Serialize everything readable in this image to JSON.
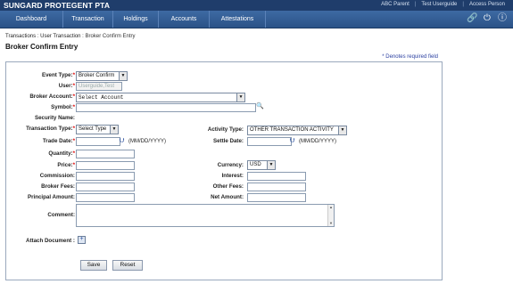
{
  "brand": "SUNGARD PROTEGENT PTA",
  "top_links": [
    "ABC Parent",
    "Test Userguide",
    "Access Person"
  ],
  "nav": {
    "items": [
      "Dashboard",
      "Transaction",
      "Holdings",
      "Accounts",
      "Attestations"
    ],
    "icons": [
      "link-icon",
      "power-icon",
      "help-icon"
    ]
  },
  "breadcrumb": [
    "Transactions",
    "User Transaction",
    "Broker Confirm Entry"
  ],
  "page_title": "Broker Confirm Entry",
  "required_note": "* Denotes required field",
  "form": {
    "event_type": {
      "label": "Event Type:",
      "value": "Broker Confirm"
    },
    "user": {
      "label": "User:",
      "placeholder": "Userguide,Test"
    },
    "broker_account": {
      "label": "Broker Account:",
      "value": "Select Account"
    },
    "symbol": {
      "label": "Symbol:",
      "value": ""
    },
    "security_name": {
      "label": "Security Name:"
    },
    "transaction_type": {
      "label": "Transaction Type:",
      "value": "Select Type"
    },
    "activity_type": {
      "label": "Activity Type:",
      "value": "OTHER TRANSACTION ACTIVITY"
    },
    "trade_date": {
      "label": "Trade Date:",
      "format": "(MM/DD/YYYY)"
    },
    "settle_date": {
      "label": "Settle Date:",
      "format": "(MM/DD/YYYY)"
    },
    "quantity": {
      "label": "Quantity:"
    },
    "price": {
      "label": "Price:"
    },
    "currency": {
      "label": "Currency:",
      "value": "USD"
    },
    "commission": {
      "label": "Commission:"
    },
    "interest": {
      "label": "Interest:"
    },
    "broker_fees": {
      "label": "Broker Fees:"
    },
    "other_fees": {
      "label": "Other Fees:"
    },
    "principal_amount": {
      "label": "Principal Amount:"
    },
    "net_amount": {
      "label": "Net Amount:"
    },
    "comment": {
      "label": "Comment:"
    },
    "attach_document": {
      "label": "Attach Document :"
    }
  },
  "buttons": {
    "save": "Save",
    "reset": "Reset"
  },
  "colors": {
    "topbar": "#1f3d6b",
    "navbar": "#2f5a92",
    "required": "#dd0000"
  }
}
